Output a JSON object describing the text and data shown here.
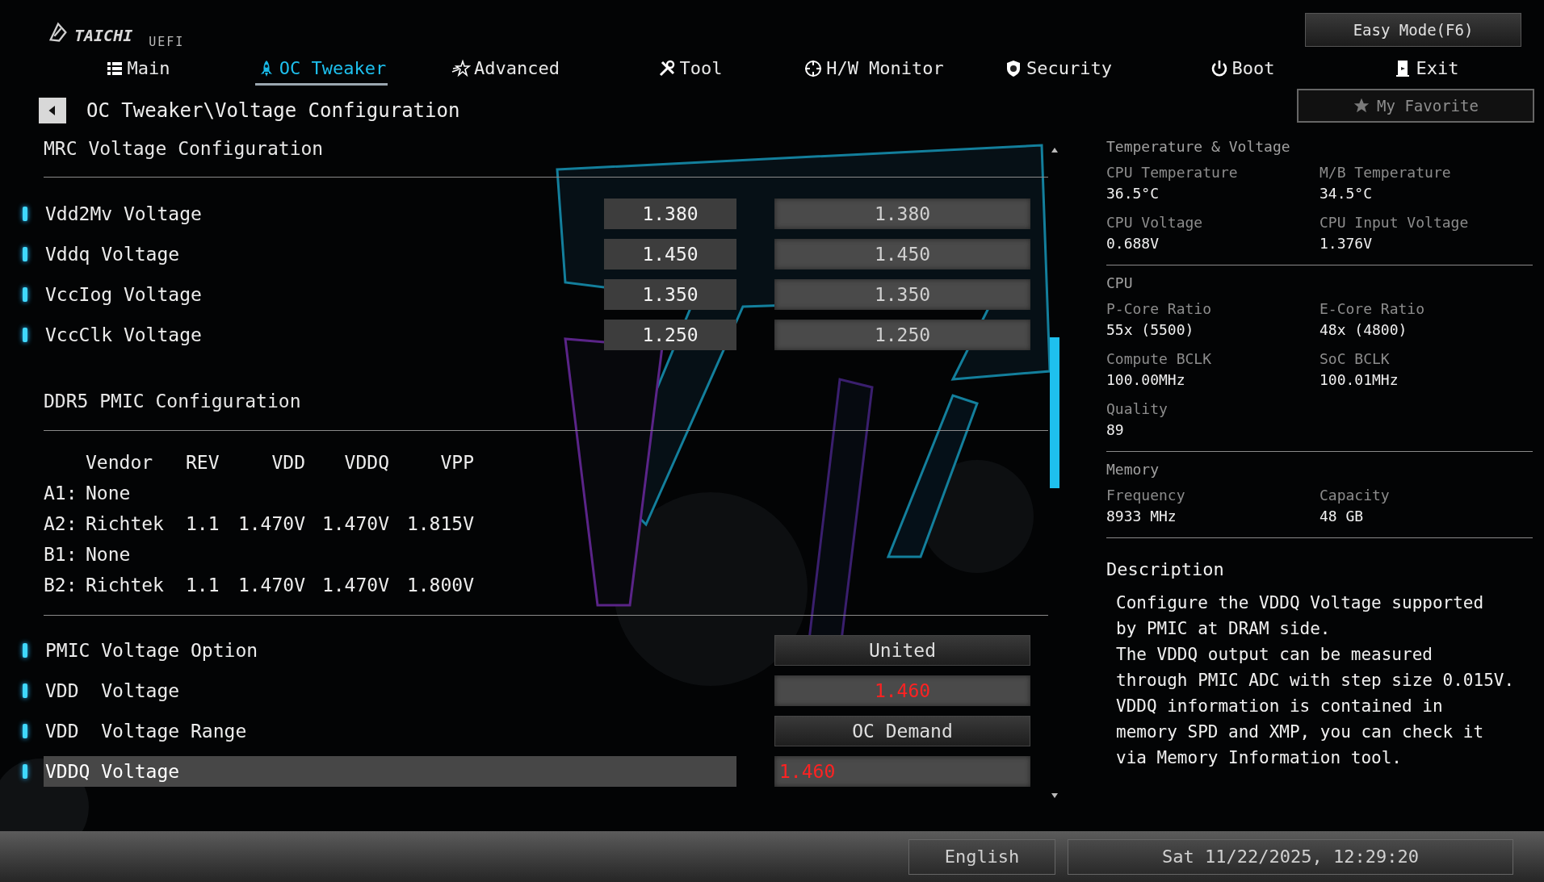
{
  "brand": {
    "name": "TAICHI",
    "suffix": "UEFI"
  },
  "easy_mode_button": "Easy Mode(F6)",
  "tabs": [
    {
      "label": "Main",
      "selected": false
    },
    {
      "label": "OC Tweaker",
      "selected": true
    },
    {
      "label": "Advanced",
      "selected": false
    },
    {
      "label": "Tool",
      "selected": false
    },
    {
      "label": "H/W Monitor",
      "selected": false
    },
    {
      "label": "Security",
      "selected": false
    },
    {
      "label": "Boot",
      "selected": false
    },
    {
      "label": "Exit",
      "selected": false
    }
  ],
  "breadcrumb": "OC Tweaker\\Voltage Configuration",
  "favorite_button": "My Favorite",
  "mrc": {
    "title": "MRC Voltage Configuration",
    "rows": [
      {
        "label": "Vdd2Mv Voltage",
        "current": "1.380",
        "value": "1.380",
        "selected": false
      },
      {
        "label": "Vddq Voltage",
        "current": "1.450",
        "value": "1.450",
        "selected": false
      },
      {
        "label": "VccIog Voltage",
        "current": "1.350",
        "value": "1.350",
        "selected": false
      },
      {
        "label": "VccClk Voltage",
        "current": "1.250",
        "value": "1.250",
        "selected": false
      }
    ]
  },
  "pmic": {
    "title": "DDR5 PMIC Configuration",
    "columns": [
      "Vendor",
      "REV",
      "VDD",
      "VDDQ",
      "VPP"
    ],
    "rows": [
      {
        "slot": "A1:",
        "cells": [
          "None"
        ]
      },
      {
        "slot": "A2:",
        "cells": [
          "Richtek",
          "1.1",
          "1.470V",
          "1.470V",
          "1.815V"
        ]
      },
      {
        "slot": "B1:",
        "cells": [
          "None"
        ]
      },
      {
        "slot": "B2:",
        "cells": [
          "Richtek",
          "1.1",
          "1.470V",
          "1.470V",
          "1.800V"
        ]
      }
    ]
  },
  "options": [
    {
      "label": "PMIC Voltage Option",
      "value": "United",
      "kind": "select",
      "changed": false,
      "editing": false,
      "selected": false
    },
    {
      "label": "VDD  Voltage",
      "value": "1.460",
      "kind": "number",
      "changed": true,
      "editing": false,
      "selected": false
    },
    {
      "label": "VDD  Voltage Range",
      "value": "OC Demand",
      "kind": "select",
      "changed": false,
      "editing": false,
      "selected": false
    },
    {
      "label": "VDDQ Voltage",
      "value": "1.460",
      "kind": "number",
      "changed": true,
      "editing": true,
      "selected": true
    }
  ],
  "monitor": [
    {
      "title": "Temperature & Voltage",
      "items": [
        {
          "label": "CPU Temperature",
          "value": "36.5°C"
        },
        {
          "label": "M/B Temperature",
          "value": "34.5°C"
        },
        {
          "label": "CPU Voltage",
          "value": "0.688V"
        },
        {
          "label": "CPU Input Voltage",
          "value": "1.376V"
        }
      ]
    },
    {
      "title": "CPU",
      "items": [
        {
          "label": "P-Core Ratio",
          "value": "55x (5500)"
        },
        {
          "label": "E-Core Ratio",
          "value": "48x (4800)"
        },
        {
          "label": "Compute BCLK",
          "value": "100.00MHz"
        },
        {
          "label": "SoC BCLK",
          "value": "100.01MHz"
        },
        {
          "label": "Quality",
          "value": "89"
        }
      ]
    },
    {
      "title": "Memory",
      "items": [
        {
          "label": "Frequency",
          "value": "8933 MHz"
        },
        {
          "label": "Capacity",
          "value": "48 GB"
        }
      ]
    }
  ],
  "description": {
    "title": "Description",
    "text": "Configure the VDDQ Voltage supported\nby PMIC at DRAM side.\nThe VDDQ output can be measured\nthrough PMIC ADC with step size 0.015V.\nVDDQ information is contained in\nmemory SPD and XMP, you can check it\nvia Memory Information tool."
  },
  "footer": {
    "language": "English",
    "datetime": "Sat 11/22/2025, 12:29:20"
  }
}
